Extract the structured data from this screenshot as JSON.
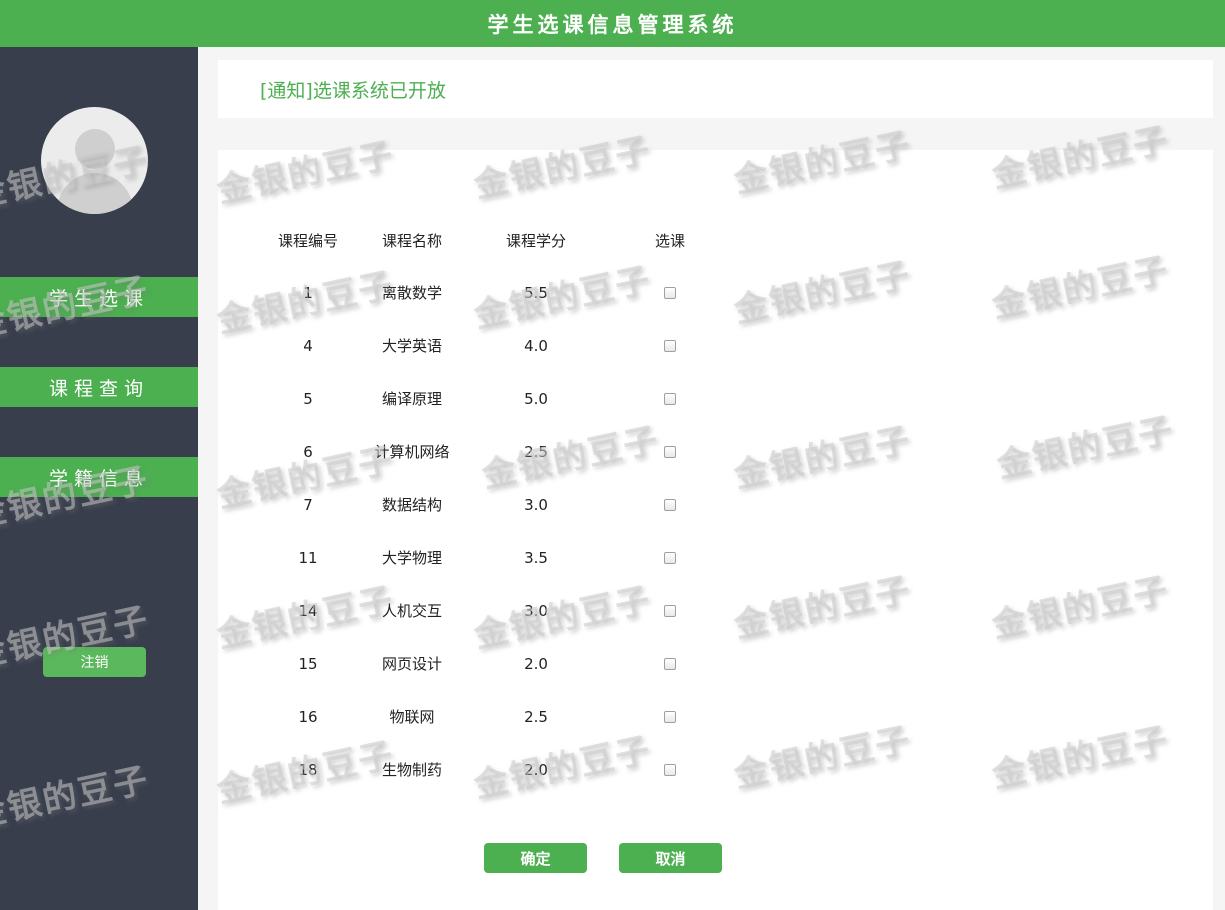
{
  "header": {
    "title": "学生选课信息管理系统"
  },
  "sidebar": {
    "avatar_icon": "user-avatar-icon",
    "nav": [
      "学生选课",
      "课程查询",
      "学籍信息"
    ],
    "logout_label": "注销"
  },
  "notice": {
    "text": "[通知]选课系统已开放"
  },
  "table": {
    "headers": [
      "课程编号",
      "课程名称",
      "课程学分",
      "选课"
    ],
    "rows": [
      {
        "id": "1",
        "name": "离散数学",
        "credit": "5.5",
        "selected": false
      },
      {
        "id": "4",
        "name": "大学英语",
        "credit": "4.0",
        "selected": false
      },
      {
        "id": "5",
        "name": "编译原理",
        "credit": "5.0",
        "selected": false
      },
      {
        "id": "6",
        "name": "计算机网络",
        "credit": "2.5",
        "selected": false
      },
      {
        "id": "7",
        "name": "数据结构",
        "credit": "3.0",
        "selected": false
      },
      {
        "id": "11",
        "name": "大学物理",
        "credit": "3.5",
        "selected": false
      },
      {
        "id": "14",
        "name": "人机交互",
        "credit": "3.0",
        "selected": false
      },
      {
        "id": "15",
        "name": "网页设计",
        "credit": "2.0",
        "selected": false
      },
      {
        "id": "16",
        "name": "物联网",
        "credit": "2.5",
        "selected": false
      },
      {
        "id": "18",
        "name": "生物制药",
        "credit": "2.0",
        "selected": false
      }
    ]
  },
  "actions": {
    "confirm_label": "确定",
    "cancel_label": "取消"
  },
  "watermark": {
    "text": "金银的豆子"
  },
  "colors": {
    "accent": "#4caf50",
    "sidebar_bg": "#383e4c"
  }
}
